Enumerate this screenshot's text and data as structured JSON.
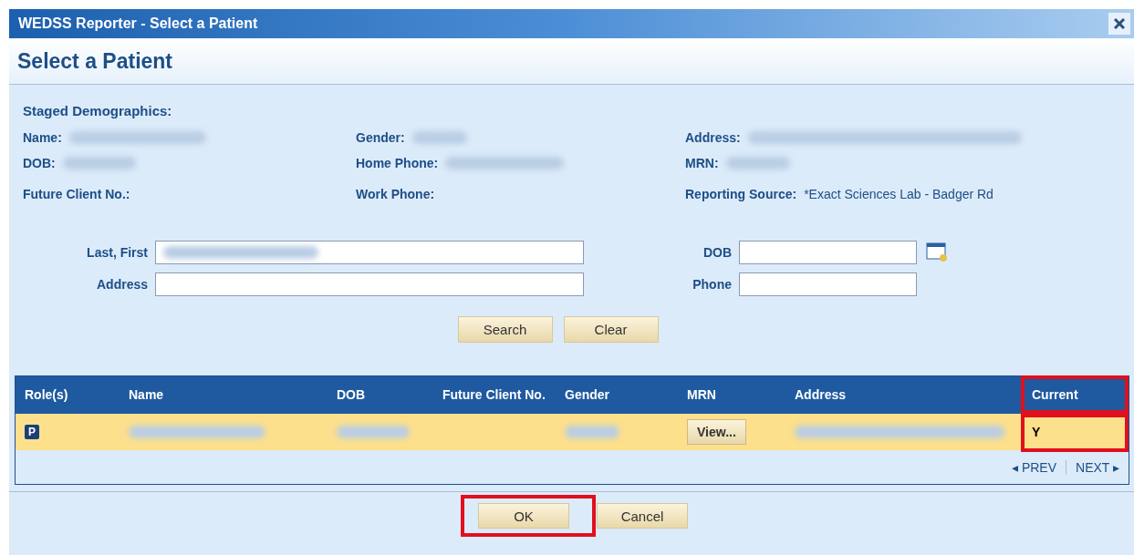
{
  "window": {
    "title": "WEDSS Reporter - Select a Patient"
  },
  "header": {
    "title": "Select a Patient"
  },
  "demographics": {
    "heading": "Staged Demographics:",
    "columns": [
      [
        {
          "label": "Name:",
          "redacted": true
        },
        {
          "label": "DOB:",
          "redacted": true
        },
        {
          "label": "Future Client No.:",
          "redacted": false
        }
      ],
      [
        {
          "label": "Gender:",
          "redacted": true
        },
        {
          "label": "Home Phone:",
          "redacted": true
        },
        {
          "label": "Work Phone:",
          "redacted": false
        }
      ],
      [
        {
          "label": "Address:",
          "redacted": true
        },
        {
          "label": "MRN:",
          "redacted": true
        },
        {
          "label": "Reporting Source:",
          "redacted": false,
          "value": "*Exact Sciences Lab - Badger Rd"
        }
      ]
    ]
  },
  "search": {
    "fields": [
      {
        "label": "Last, First",
        "redacted": true
      },
      {
        "label": "DOB",
        "redacted": false,
        "calendar": true
      },
      {
        "label": "Address",
        "redacted": false
      },
      {
        "label": "Phone",
        "redacted": false
      }
    ],
    "buttons": [
      "Search",
      "Clear"
    ]
  },
  "table": {
    "columns": [
      {
        "label": "Role(s)",
        "highlighted": false
      },
      {
        "label": "Name",
        "highlighted": false
      },
      {
        "label": "DOB",
        "highlighted": false
      },
      {
        "label": "Future Client No.",
        "highlighted": false
      },
      {
        "label": "Gender",
        "highlighted": false
      },
      {
        "label": "MRN",
        "highlighted": false
      },
      {
        "label": "Address",
        "highlighted": false
      },
      {
        "label": "Current",
        "highlighted": true
      }
    ],
    "rows": [
      {
        "selected": true,
        "cells": [
          {
            "kind": "badge",
            "text": "P"
          },
          {
            "kind": "redacted"
          },
          {
            "kind": "redacted"
          },
          {
            "kind": "empty"
          },
          {
            "kind": "redacted"
          },
          {
            "kind": "button",
            "text": "View..."
          },
          {
            "kind": "redacted"
          },
          {
            "kind": "text",
            "text": "Y"
          }
        ]
      }
    ],
    "pager": {
      "prev": "◂ PREV",
      "next": "NEXT ▸"
    }
  },
  "buttons": [
    {
      "label": "OK",
      "highlighted": true
    },
    {
      "label": "Cancel",
      "highlighted": false
    }
  ]
}
